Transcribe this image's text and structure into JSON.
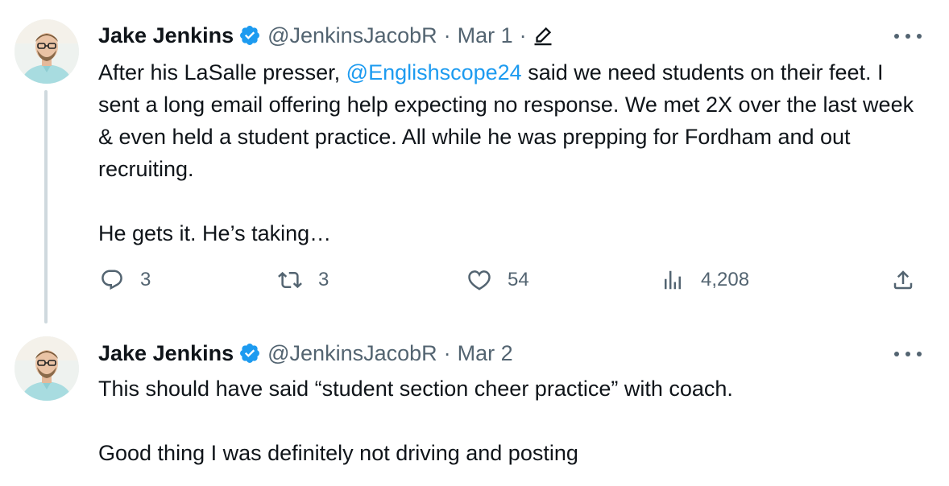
{
  "tweets": [
    {
      "name": "Jake Jenkins",
      "handle": "@JenkinsJacobR",
      "separator": "·",
      "date": "Mar 1",
      "separator2": "·",
      "text": {
        "before_mention": "After his LaSalle presser, ",
        "mention": "@Englishscope24",
        "after_mention": " said we need students on their feet. I sent a long email offering help expecting no response. We met 2X over the last week & even held a student practice. All while he was prepping for Fordham and out recruiting.",
        "paragraph2": "He gets it. He’s taking…"
      },
      "actions": {
        "replies": "3",
        "retweets": "3",
        "likes": "54",
        "views": "4,208"
      }
    },
    {
      "name": "Jake Jenkins",
      "handle": "@JenkinsJacobR",
      "separator": "·",
      "date": "Mar 2",
      "text": {
        "paragraph1": "This should have said “student section cheer practice” with coach.",
        "paragraph2": "Good thing I was definitely not driving and posting"
      }
    }
  ],
  "icons": {
    "verified": "verified-badge-icon",
    "edit": "edit-pencil-icon",
    "more": "more-options-icon",
    "reply": "reply-icon",
    "retweet": "retweet-icon",
    "like": "heart-icon",
    "views": "views-chart-icon",
    "share": "share-icon"
  },
  "colors": {
    "link": "#1d9bf0",
    "secondary_text": "#536471",
    "primary_text": "#0f1419",
    "verified": "#1d9bf0",
    "thread_line": "#cfd9de"
  }
}
